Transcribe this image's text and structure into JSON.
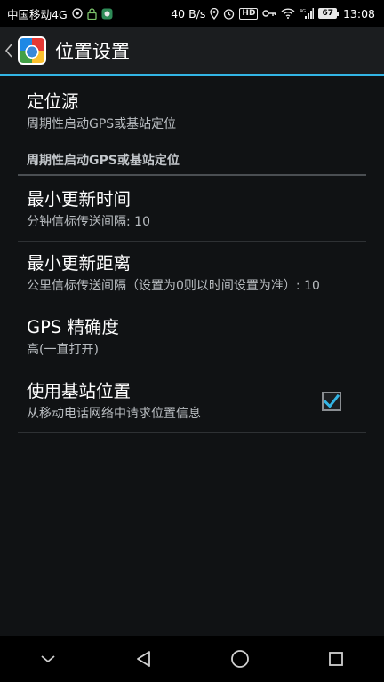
{
  "status_bar": {
    "carrier": "中国移动4G",
    "net_speed": "40 B/s",
    "hd_label": "HD",
    "signal_label": "4G",
    "battery": "67",
    "time": "13:08"
  },
  "action_bar": {
    "title": "位置设置"
  },
  "preferences": {
    "location_source": {
      "title": "定位源",
      "summary": "周期性启动GPS或基站定位"
    },
    "category_header": "周期性启动GPS或基站定位",
    "min_update_time": {
      "title": "最小更新时间",
      "summary": "分钟信标传送间隔: 10"
    },
    "min_update_distance": {
      "title": "最小更新距离",
      "summary": "公里信标传送间隔（设置为0则以时间设置为准）: 10"
    },
    "gps_accuracy": {
      "title": "GPS 精确度",
      "summary": "高(一直打开)"
    },
    "use_cell_location": {
      "title": "使用基站位置",
      "summary": "从移动电话网络中请求位置信息",
      "checked": true
    }
  },
  "colors": {
    "accent": "#33b5e5",
    "background": "#101214",
    "summary_text": "#b8bcc0"
  },
  "icons": {
    "back": "chevron-left-icon",
    "nav_back": "triangle-back-icon",
    "nav_home": "circle-home-icon",
    "nav_recent": "square-recent-icon",
    "nav_hide": "chevron-down-icon"
  }
}
